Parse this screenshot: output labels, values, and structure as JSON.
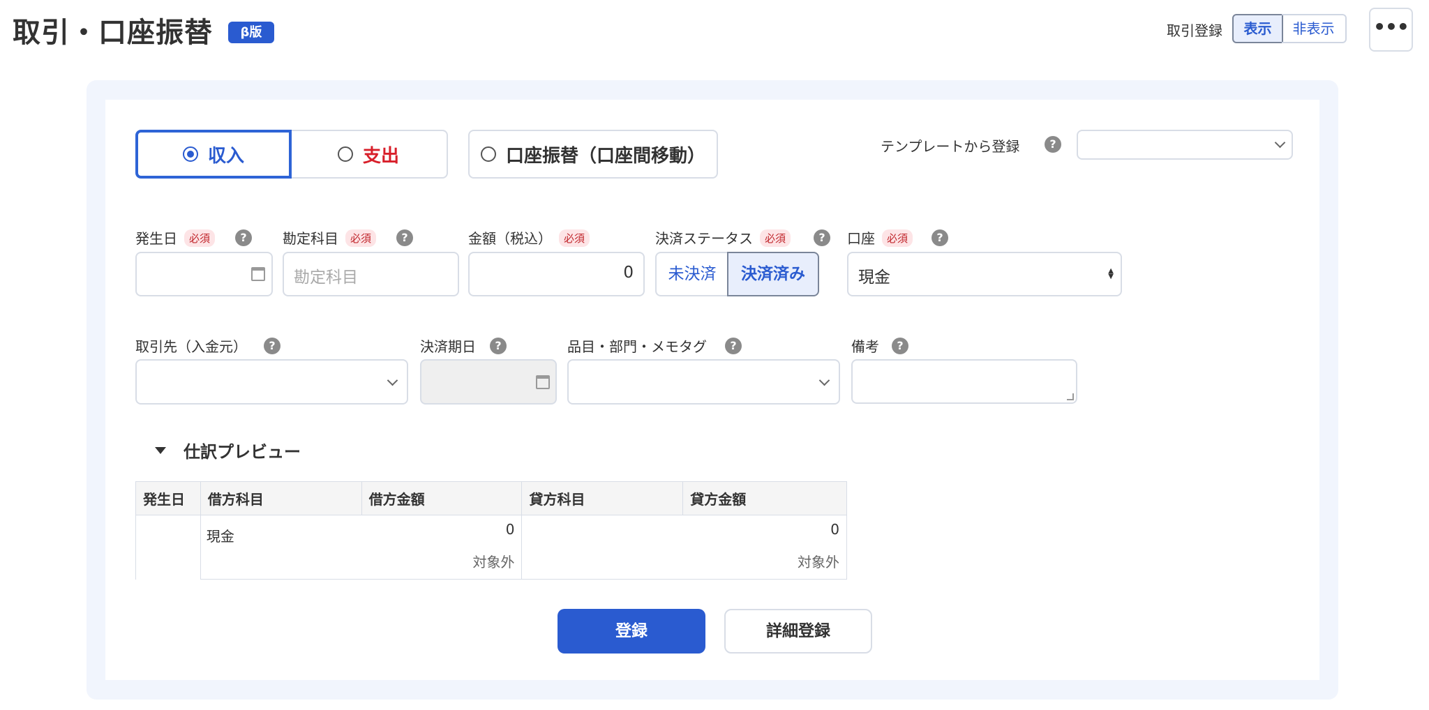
{
  "header": {
    "title": "取引・口座振替",
    "beta_badge": "β版",
    "toggle_label": "取引登録",
    "toggle_show": "表示",
    "toggle_hide": "非表示",
    "more_label": "•••"
  },
  "type_tabs": {
    "income": "収入",
    "expense": "支出",
    "transfer": "口座振替（口座間移動）",
    "selected": "income"
  },
  "template": {
    "label": "テンプレートから登録",
    "value": ""
  },
  "help_mark": "?",
  "required_badge": "必須",
  "fields": {
    "date": {
      "label": "発生日",
      "value": ""
    },
    "account_item": {
      "label": "勘定科目",
      "placeholder": "勘定科目"
    },
    "amount": {
      "label": "金額（税込）",
      "value": "0"
    },
    "status": {
      "label": "決済ステータス",
      "unpaid": "未決済",
      "paid": "決済済み",
      "selected": "paid"
    },
    "wallet": {
      "label": "口座",
      "value": "現金"
    },
    "partner": {
      "label": "取引先（入金元）",
      "value": ""
    },
    "due_date": {
      "label": "決済期日",
      "value": ""
    },
    "tags": {
      "label": "品目・部門・メモタグ",
      "value": ""
    },
    "memo": {
      "label": "備考",
      "value": ""
    }
  },
  "preview": {
    "title": "仕訳プレビュー",
    "columns": [
      "発生日",
      "借方科目",
      "借方金額",
      "貸方科目",
      "貸方金額"
    ],
    "row": {
      "date": "",
      "debit_account": "現金",
      "debit_amount": "0",
      "debit_tax": "対象外",
      "credit_account": "",
      "credit_amount": "0",
      "credit_tax": "対象外"
    }
  },
  "buttons": {
    "register": "登録",
    "detail_register": "詳細登録"
  },
  "colors": {
    "primary": "#2a5bd0",
    "expense_red": "#d81f2a",
    "panel_bg": "#f1f5fd",
    "required_bg": "#fde4e6"
  }
}
